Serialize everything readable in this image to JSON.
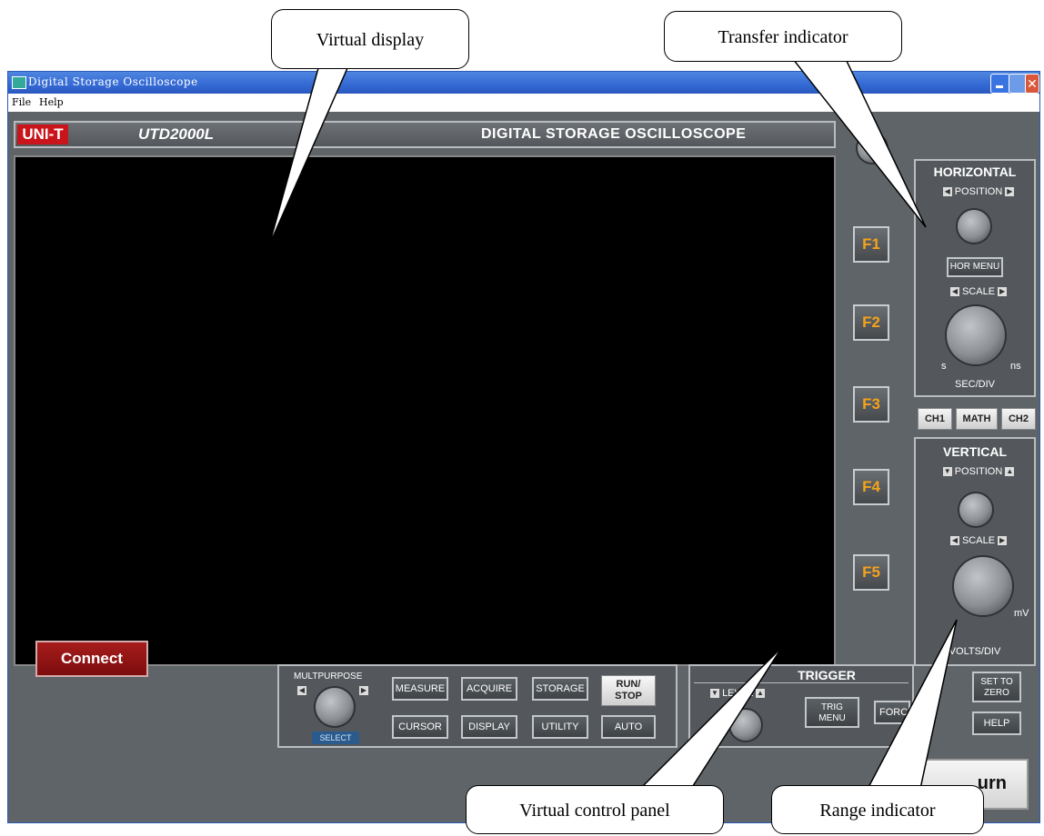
{
  "window": {
    "title": "Digital Storage Oscilloscope",
    "menu": [
      "File",
      "Help"
    ]
  },
  "header": {
    "brand": "UNI-T",
    "model": "UTD2000L",
    "product": "DIGITAL STORAGE OSCILLOSCOPE"
  },
  "function_keys": [
    "F1",
    "F2",
    "F3",
    "F4",
    "F5"
  ],
  "horizontal": {
    "title": "HORIZONTAL",
    "position_label": "POSITION",
    "menu_button": "HOR MENU",
    "scale_label": "SCALE",
    "scale_left": "s",
    "scale_right": "ns",
    "units": "SEC/DIV"
  },
  "channels": [
    "CH1",
    "MATH",
    "CH2"
  ],
  "vertical": {
    "title": "VERTICAL",
    "position_label": "POSITION",
    "scale_label": "SCALE",
    "scale_right": "mV",
    "units": "VOLTS/DIV"
  },
  "control_panel": {
    "multipurpose_label": "MULTPURPOSE",
    "select_label": "SELECT",
    "buttons_top": [
      "MEASURE",
      "ACQUIRE",
      "STORAGE"
    ],
    "buttons_bottom": [
      "CURSOR",
      "DISPLAY",
      "UTILITY"
    ],
    "run_stop": "RUN/ STOP",
    "auto": "AUTO"
  },
  "trigger": {
    "title": "TRIGGER",
    "level_label": "LEVEL",
    "trig_menu": "TRIG MENU",
    "force": "FORC"
  },
  "right_buttons": {
    "set_to_zero": "SET TO ZERO",
    "help": "HELP",
    "return_partial": "urn"
  },
  "connect_button": "Connect",
  "callouts": {
    "virtual_display": "Virtual display",
    "transfer_indicator": "Transfer indicator",
    "virtual_control_panel": "Virtual control panel",
    "range_indicator": "Range indicator"
  },
  "colors": {
    "panel": "#54585c",
    "function_key_text": "#f4a21a",
    "brand_red": "#c8141a",
    "connect_red": "#8e1313"
  }
}
